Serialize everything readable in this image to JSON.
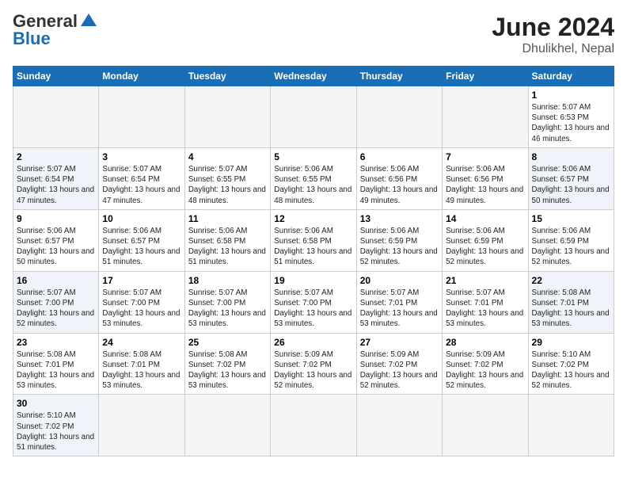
{
  "header": {
    "logo_general": "General",
    "logo_blue": "Blue",
    "month_title": "June 2024",
    "location": "Dhulikhel, Nepal"
  },
  "weekdays": [
    "Sunday",
    "Monday",
    "Tuesday",
    "Wednesday",
    "Thursday",
    "Friday",
    "Saturday"
  ],
  "weeks": [
    [
      {
        "day": "",
        "sunrise": "",
        "sunset": "",
        "daylight": "",
        "empty": true
      },
      {
        "day": "",
        "sunrise": "",
        "sunset": "",
        "daylight": "",
        "empty": true
      },
      {
        "day": "",
        "sunrise": "",
        "sunset": "",
        "daylight": "",
        "empty": true
      },
      {
        "day": "",
        "sunrise": "",
        "sunset": "",
        "daylight": "",
        "empty": true
      },
      {
        "day": "",
        "sunrise": "",
        "sunset": "",
        "daylight": "",
        "empty": true
      },
      {
        "day": "",
        "sunrise": "",
        "sunset": "",
        "daylight": "",
        "empty": true
      },
      {
        "day": "1",
        "sunrise": "Sunrise: 5:07 AM",
        "sunset": "Sunset: 6:53 PM",
        "daylight": "Daylight: 13 hours and 46 minutes.",
        "empty": false
      }
    ],
    [
      {
        "day": "2",
        "sunrise": "Sunrise: 5:07 AM",
        "sunset": "Sunset: 6:54 PM",
        "daylight": "Daylight: 13 hours and 47 minutes.",
        "empty": false
      },
      {
        "day": "3",
        "sunrise": "Sunrise: 5:07 AM",
        "sunset": "Sunset: 6:54 PM",
        "daylight": "Daylight: 13 hours and 47 minutes.",
        "empty": false
      },
      {
        "day": "4",
        "sunrise": "Sunrise: 5:07 AM",
        "sunset": "Sunset: 6:55 PM",
        "daylight": "Daylight: 13 hours and 48 minutes.",
        "empty": false
      },
      {
        "day": "5",
        "sunrise": "Sunrise: 5:06 AM",
        "sunset": "Sunset: 6:55 PM",
        "daylight": "Daylight: 13 hours and 48 minutes.",
        "empty": false
      },
      {
        "day": "6",
        "sunrise": "Sunrise: 5:06 AM",
        "sunset": "Sunset: 6:56 PM",
        "daylight": "Daylight: 13 hours and 49 minutes.",
        "empty": false
      },
      {
        "day": "7",
        "sunrise": "Sunrise: 5:06 AM",
        "sunset": "Sunset: 6:56 PM",
        "daylight": "Daylight: 13 hours and 49 minutes.",
        "empty": false
      },
      {
        "day": "8",
        "sunrise": "Sunrise: 5:06 AM",
        "sunset": "Sunset: 6:57 PM",
        "daylight": "Daylight: 13 hours and 50 minutes.",
        "empty": false
      }
    ],
    [
      {
        "day": "9",
        "sunrise": "Sunrise: 5:06 AM",
        "sunset": "Sunset: 6:57 PM",
        "daylight": "Daylight: 13 hours and 50 minutes.",
        "empty": false
      },
      {
        "day": "10",
        "sunrise": "Sunrise: 5:06 AM",
        "sunset": "Sunset: 6:57 PM",
        "daylight": "Daylight: 13 hours and 51 minutes.",
        "empty": false
      },
      {
        "day": "11",
        "sunrise": "Sunrise: 5:06 AM",
        "sunset": "Sunset: 6:58 PM",
        "daylight": "Daylight: 13 hours and 51 minutes.",
        "empty": false
      },
      {
        "day": "12",
        "sunrise": "Sunrise: 5:06 AM",
        "sunset": "Sunset: 6:58 PM",
        "daylight": "Daylight: 13 hours and 51 minutes.",
        "empty": false
      },
      {
        "day": "13",
        "sunrise": "Sunrise: 5:06 AM",
        "sunset": "Sunset: 6:59 PM",
        "daylight": "Daylight: 13 hours and 52 minutes.",
        "empty": false
      },
      {
        "day": "14",
        "sunrise": "Sunrise: 5:06 AM",
        "sunset": "Sunset: 6:59 PM",
        "daylight": "Daylight: 13 hours and 52 minutes.",
        "empty": false
      },
      {
        "day": "15",
        "sunrise": "Sunrise: 5:06 AM",
        "sunset": "Sunset: 6:59 PM",
        "daylight": "Daylight: 13 hours and 52 minutes.",
        "empty": false
      }
    ],
    [
      {
        "day": "16",
        "sunrise": "Sunrise: 5:07 AM",
        "sunset": "Sunset: 7:00 PM",
        "daylight": "Daylight: 13 hours and 52 minutes.",
        "empty": false
      },
      {
        "day": "17",
        "sunrise": "Sunrise: 5:07 AM",
        "sunset": "Sunset: 7:00 PM",
        "daylight": "Daylight: 13 hours and 53 minutes.",
        "empty": false
      },
      {
        "day": "18",
        "sunrise": "Sunrise: 5:07 AM",
        "sunset": "Sunset: 7:00 PM",
        "daylight": "Daylight: 13 hours and 53 minutes.",
        "empty": false
      },
      {
        "day": "19",
        "sunrise": "Sunrise: 5:07 AM",
        "sunset": "Sunset: 7:00 PM",
        "daylight": "Daylight: 13 hours and 53 minutes.",
        "empty": false
      },
      {
        "day": "20",
        "sunrise": "Sunrise: 5:07 AM",
        "sunset": "Sunset: 7:01 PM",
        "daylight": "Daylight: 13 hours and 53 minutes.",
        "empty": false
      },
      {
        "day": "21",
        "sunrise": "Sunrise: 5:07 AM",
        "sunset": "Sunset: 7:01 PM",
        "daylight": "Daylight: 13 hours and 53 minutes.",
        "empty": false
      },
      {
        "day": "22",
        "sunrise": "Sunrise: 5:08 AM",
        "sunset": "Sunset: 7:01 PM",
        "daylight": "Daylight: 13 hours and 53 minutes.",
        "empty": false
      }
    ],
    [
      {
        "day": "23",
        "sunrise": "Sunrise: 5:08 AM",
        "sunset": "Sunset: 7:01 PM",
        "daylight": "Daylight: 13 hours and 53 minutes.",
        "empty": false
      },
      {
        "day": "24",
        "sunrise": "Sunrise: 5:08 AM",
        "sunset": "Sunset: 7:01 PM",
        "daylight": "Daylight: 13 hours and 53 minutes.",
        "empty": false
      },
      {
        "day": "25",
        "sunrise": "Sunrise: 5:08 AM",
        "sunset": "Sunset: 7:02 PM",
        "daylight": "Daylight: 13 hours and 53 minutes.",
        "empty": false
      },
      {
        "day": "26",
        "sunrise": "Sunrise: 5:09 AM",
        "sunset": "Sunset: 7:02 PM",
        "daylight": "Daylight: 13 hours and 52 minutes.",
        "empty": false
      },
      {
        "day": "27",
        "sunrise": "Sunrise: 5:09 AM",
        "sunset": "Sunset: 7:02 PM",
        "daylight": "Daylight: 13 hours and 52 minutes.",
        "empty": false
      },
      {
        "day": "28",
        "sunrise": "Sunrise: 5:09 AM",
        "sunset": "Sunset: 7:02 PM",
        "daylight": "Daylight: 13 hours and 52 minutes.",
        "empty": false
      },
      {
        "day": "29",
        "sunrise": "Sunrise: 5:10 AM",
        "sunset": "Sunset: 7:02 PM",
        "daylight": "Daylight: 13 hours and 52 minutes.",
        "empty": false
      }
    ],
    [
      {
        "day": "30",
        "sunrise": "Sunrise: 5:10 AM",
        "sunset": "Sunset: 7:02 PM",
        "daylight": "Daylight: 13 hours and 51 minutes.",
        "empty": false
      },
      {
        "day": "",
        "sunrise": "",
        "sunset": "",
        "daylight": "",
        "empty": true
      },
      {
        "day": "",
        "sunrise": "",
        "sunset": "",
        "daylight": "",
        "empty": true
      },
      {
        "day": "",
        "sunrise": "",
        "sunset": "",
        "daylight": "",
        "empty": true
      },
      {
        "day": "",
        "sunrise": "",
        "sunset": "",
        "daylight": "",
        "empty": true
      },
      {
        "day": "",
        "sunrise": "",
        "sunset": "",
        "daylight": "",
        "empty": true
      },
      {
        "day": "",
        "sunrise": "",
        "sunset": "",
        "daylight": "",
        "empty": true
      }
    ]
  ]
}
